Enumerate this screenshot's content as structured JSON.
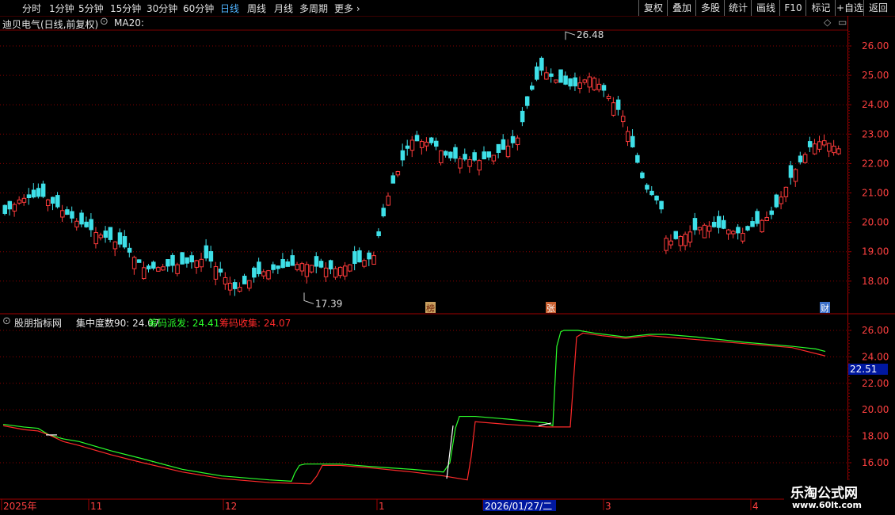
{
  "toolbar": {
    "periods": [
      "分时",
      "1分钟",
      "5分钟",
      "15分钟",
      "30分钟",
      "60分钟",
      "日线",
      "周线",
      "月线",
      "多周期"
    ],
    "active_period": "日线",
    "more": "更多 ›",
    "right_buttons": [
      "复权",
      "叠加",
      "多股",
      "统计",
      "画线",
      "F10",
      "标记",
      "+自选",
      "返回"
    ]
  },
  "main_panel": {
    "title": "迪贝电气(日线,前复权)",
    "indicator": "MA20:",
    "high_marker": "26.48",
    "low_marker": "17.39",
    "badges": [
      "榜",
      "张",
      "财"
    ],
    "y_axis_labels": [
      "26.00",
      "25.00",
      "24.00",
      "23.00",
      "22.00",
      "21.00",
      "20.00",
      "19.00",
      "18.00"
    ],
    "up_color": "#ff3b3b",
    "down_color": "#3ee0e8"
  },
  "sub_panel": {
    "title": "股朋指标网",
    "concentration": "集中度数90: 24.07",
    "distribute": "筹码派发: 24.41",
    "collect": "筹码收集: 24.07",
    "distribute_color": "#2bff2b",
    "collect_color": "#ff2a2a",
    "y_axis_labels": [
      "26.00",
      "24.00",
      "22.00",
      "20.00",
      "18.00",
      "16.00"
    ],
    "current_value": "22.51"
  },
  "x_axis": {
    "labels": [
      "2025年",
      "11",
      "12",
      "1",
      "2026/01/27/二",
      "3",
      "4"
    ]
  },
  "watermark": {
    "line1": "乐淘公式网",
    "line2": "www.60lt.com"
  }
}
